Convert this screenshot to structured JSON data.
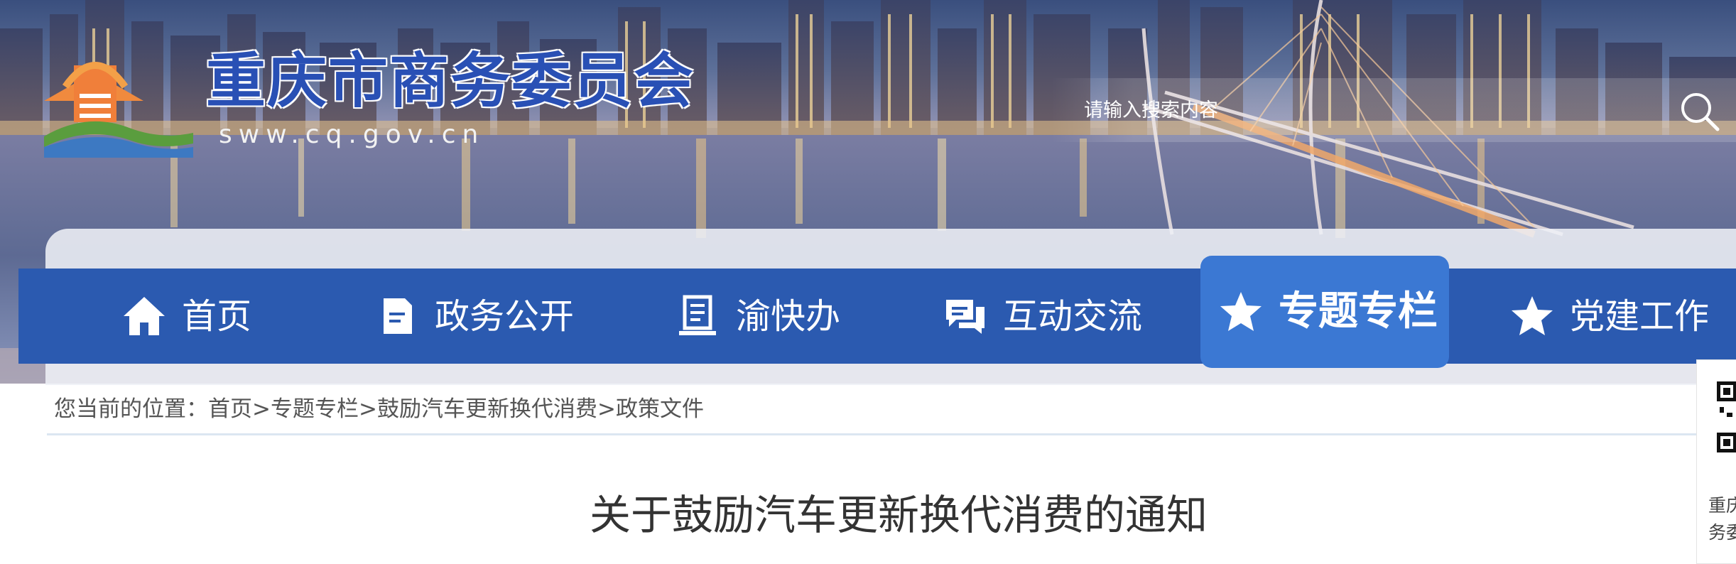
{
  "header": {
    "site_title": "重庆市商务委员会",
    "site_domain": "sww.cq.gov.cn",
    "logo_icon": "chongqing-emblem-icon",
    "search": {
      "placeholder": "请输入搜索内容",
      "value": "",
      "icon": "search-icon"
    }
  },
  "nav": {
    "items": [
      {
        "label": "首页",
        "icon": "home-icon",
        "active": false
      },
      {
        "label": "政务公开",
        "icon": "document-icon",
        "active": false
      },
      {
        "label": "渝快办",
        "icon": "service-icon",
        "active": false
      },
      {
        "label": "互动交流",
        "icon": "chat-icon",
        "active": false
      },
      {
        "label": "专题专栏",
        "icon": "star-icon",
        "active": true
      },
      {
        "label": "党建工作",
        "icon": "star-icon",
        "active": false
      }
    ],
    "colors": {
      "bar": "#2b5ab0",
      "active": "#3b78d3"
    }
  },
  "breadcrumb": {
    "prefix": "您当前的位置：",
    "items": [
      "首页",
      "专题专栏",
      "鼓励汽车更新换代消费",
      "政策文件"
    ],
    "separator": ">"
  },
  "article": {
    "title": "关于鼓励汽车更新换代消费的通知"
  },
  "side_qr": {
    "text": "重庆市商务委员会"
  }
}
